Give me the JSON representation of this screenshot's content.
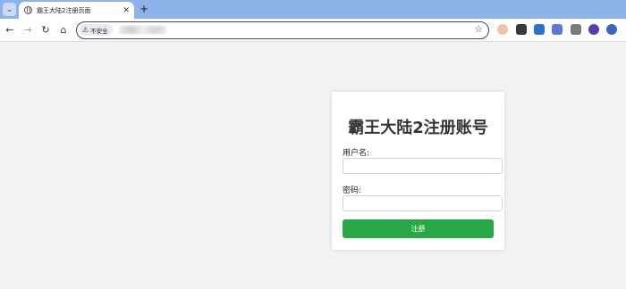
{
  "browser": {
    "tab": {
      "title": "霸王大陆2注册页面",
      "close_glyph": "✕"
    },
    "new_tab_glyph": "+",
    "tab_search_glyph": "⌄",
    "nav": {
      "back": "←",
      "forward": "→",
      "reload": "↻",
      "home": "⌂"
    },
    "address_bar": {
      "security_label": "不安全",
      "warning_glyph": "⚠",
      "bookmark_glyph": "☆"
    },
    "extension_icons": [
      "shield-ext-icon",
      "store-ext-icon",
      "download-ext-icon",
      "translate-ext-icon",
      "puzzle-ext-icon",
      "profile-ext-icon",
      "chrome-ext-icon"
    ]
  },
  "form": {
    "title": "霸王大陆2注册账号",
    "username_label": "用户名:",
    "username_value": "",
    "password_label": "密码:",
    "password_value": "",
    "submit_label": "注册"
  },
  "colors": {
    "tabstrip": "#8db3ea",
    "page_bg": "#f2f2f2",
    "submit_bg": "#28a745"
  }
}
